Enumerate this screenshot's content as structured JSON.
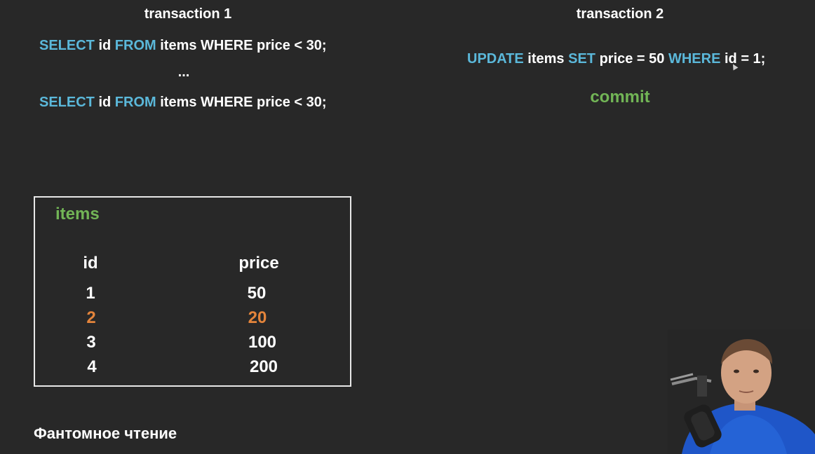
{
  "transaction1": {
    "heading": "transaction 1",
    "query1": {
      "kw_select": "SELECT",
      "part_id": " id ",
      "kw_from": "FROM",
      "part_rest": " items WHERE price < 30;"
    },
    "ellipsis": "...",
    "query2": {
      "kw_select": "SELECT",
      "part_id": " id ",
      "kw_from": "FROM",
      "part_rest": " items WHERE price < 30;"
    }
  },
  "transaction2": {
    "heading": "transaction 2",
    "update": {
      "kw_update": "UPDATE",
      "part_items": " items ",
      "kw_set": "SET",
      "part_price": " price = 50 ",
      "kw_where": "WHERE",
      "part_rest": " id = 1;"
    },
    "commit": "commit"
  },
  "table": {
    "title": "items",
    "columns": [
      "id",
      "price"
    ],
    "rows": [
      {
        "id": "1",
        "price": "50"
      },
      {
        "id": "2",
        "price": "20"
      },
      {
        "id": "3",
        "price": "100"
      },
      {
        "id": "4",
        "price": "200"
      }
    ]
  },
  "caption": "Фантомное чтение",
  "colors": {
    "background": "#282828",
    "keyword": "#5bb8da",
    "commit": "#72b556",
    "table_title": "#72b556",
    "highlight_row": "#e3843b",
    "text": "#ffffff"
  },
  "icons": [
    "cursor-icon",
    "microphone-icon"
  ]
}
